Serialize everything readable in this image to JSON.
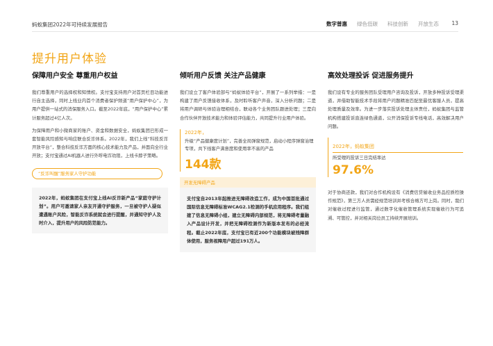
{
  "header": {
    "report_title": "蚂蚁集团2022年可持续发展报告",
    "nav": [
      "数字普惠",
      "绿色低碳",
      "科技创新",
      "开放生态"
    ],
    "active_nav": "数字普惠",
    "page_number": "13"
  },
  "section_title": "提升用户体验",
  "col1": {
    "heading": "保障用户安全 尊重用户权益",
    "para1": "我们尊重用户的选择权和知情权。支付宝支持用户对首页栏目功能进行自主选择，同时上线业内首个消费者保护频道“用户保护中心”，为用户提供一站式的消保服务入口。截至2022年底，“用户保护中心”累计服务超过4亿人次。",
    "para2": "为保障用户和小微商家的账户、资金和数据安全，蚂蚁集团已形成一套智能风险感知与响应联合反诈体系。2022年，我们上线“科技反诈开放平台”，整合科技反诈方面的核心技术能力及产品，并面向全行业开放；支付宝通过AI机器人进行外呼电诈劝阻，上线卡脖子策略。",
    "tag": "“反诈叫醒”服务家人守护功能",
    "note": "2022年，蚂蚁集团在支付宝上线AI反诈新产品“家庭守护计划”。用户可邀请家人亲友开通守护服务，一旦被守护人疑似遭遇账户风险，智能反诈系统就会进行提醒，并通知守护人及时介入，提升用户的风险防范能力。"
  },
  "col2": {
    "heading": "倾听用户反馈 关注产品健康",
    "para1": "我们设立了客户体验部与“蚂蚁体验平台”，开展了一系列举措：一是构建了用户反馈接收体系，及时聆听客户声音，深入分析问题；二是将用户调研与体验治理相结合，联动各个业务团队跟进处理；三是向合作伙伴开放技术能力和体验评估能力，共同提升行业用户体验。",
    "stat_year": "2022年，",
    "stat_desc": "升级“产品健康度计划”，完善全局弹窗规范，启动小程序弹窗治理专项，共下线客户满意度和使用率不高的产品",
    "stat_value": "144款",
    "label": "开发无障碍产品",
    "note": "支付宝自2013年起推进无障碍改造工作，成为中国首批通过国际信息无障碍标准WCAG2.1检测的手机应用程序。我们组建了信息无障碍小组，建立无障碍内部规范，将无障碍考量融入产品设计开发，并把无障碍检测作为新版本发布的必经流程。截止2022年底，支付宝已有近200个功能模块被残障群体使用，服务视障用户超过191万人。"
  },
  "col3": {
    "heading": "高效处理投诉 促进服务提升",
    "para1": "我们设有专业的服务团队受理用户咨询及投诉，开放多种投诉受理渠道，并借助智能技术手段将用户问题精准匹配至最优客服人员，提高处理质量及效率。为进一步落实投诉处理主体责任，蚂蚁集团与监管机构搭建投诉直连绿色通道，公开消保投诉专线电话，高效解决用户问题。",
    "stat_year": "2022年，蚂蚁集团",
    "stat_desc": "所受理的投诉三日完结率达",
    "stat_value": "97.6%",
    "para2": "对于协商还款，我们对合作机构设有《消费信贷催收业务品控质检操作规范》，第三方人员需经规范培训并考核合格方可上岗。同时，我们对催收过程进行监管，通过数字化催收管理系统实现催收行为可追溯、可管控，并对相关岗位员工持续开展培训。"
  },
  "colors": {
    "accent": "#f2a516",
    "text_dark": "#1a1a1a",
    "text_body": "#4a4a4a",
    "box_bg": "#f5f5f5",
    "label_bg": "#fdf0d8"
  }
}
